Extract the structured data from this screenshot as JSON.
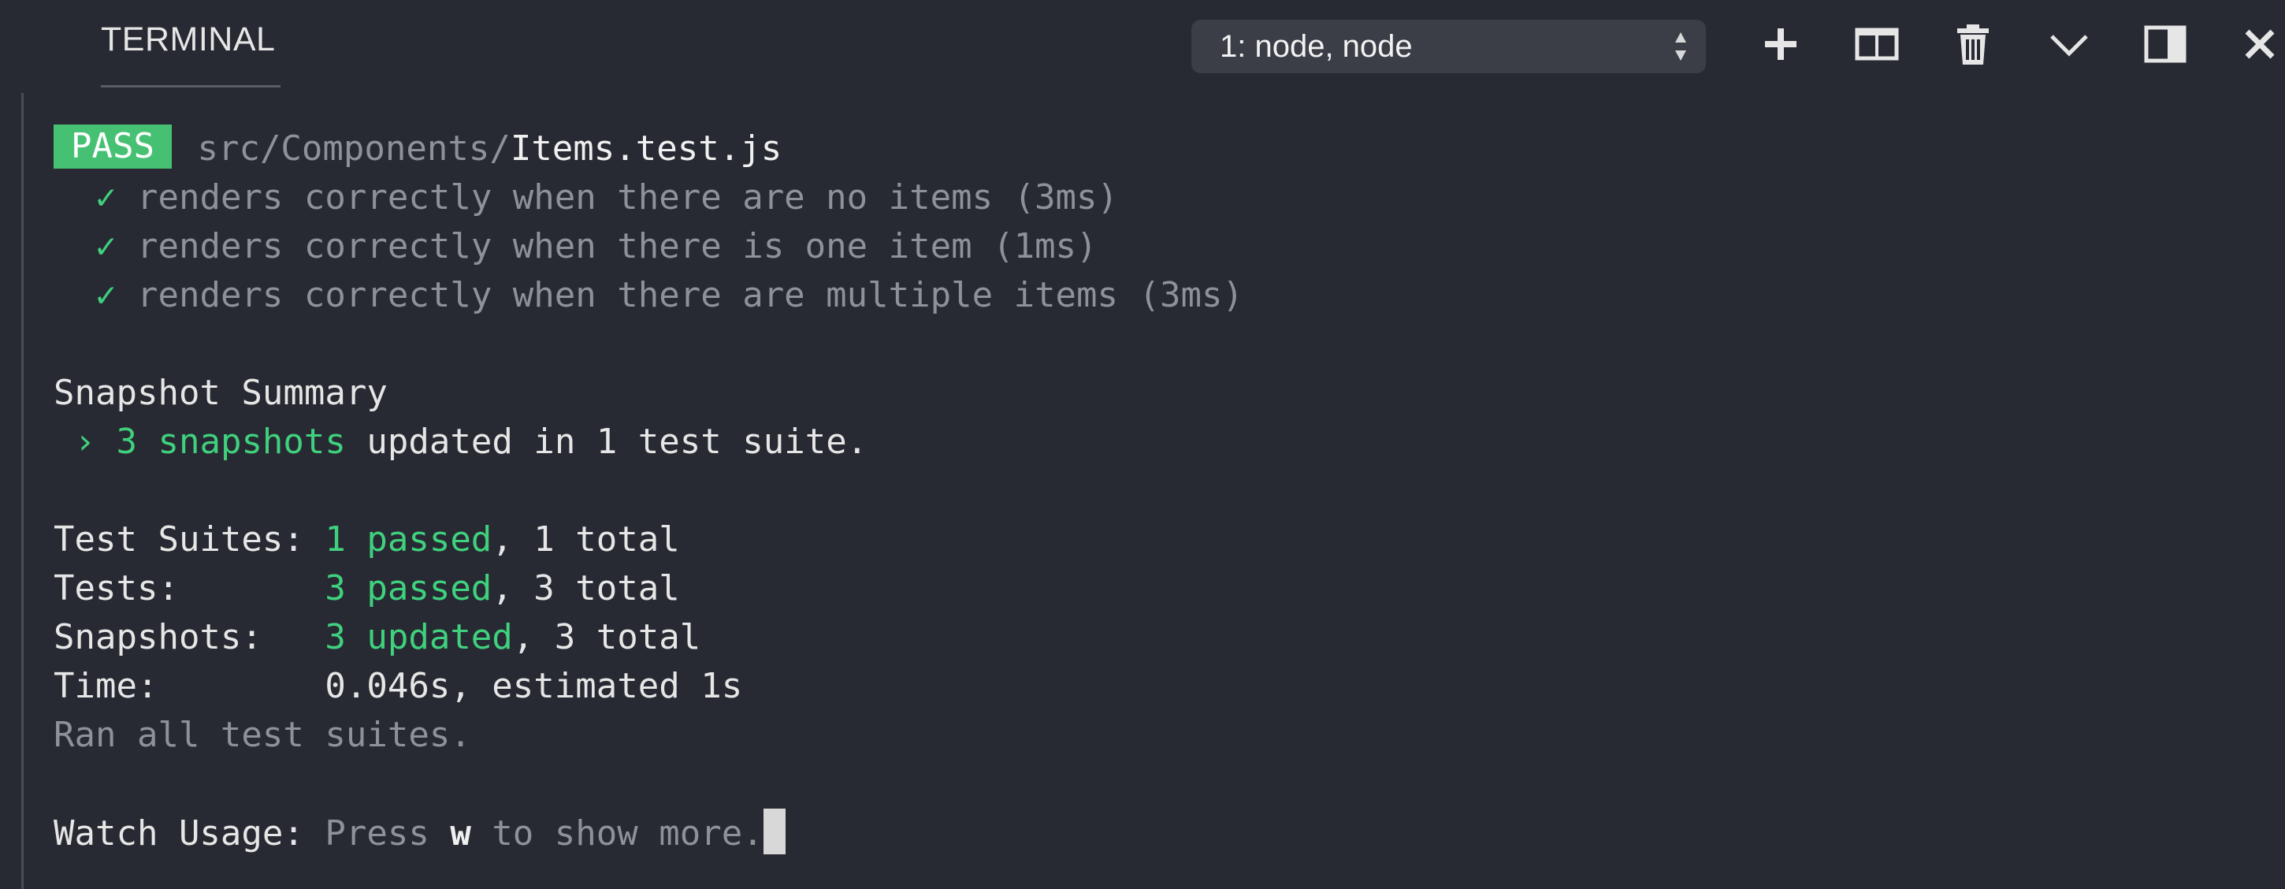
{
  "header": {
    "tab_title": "TERMINAL",
    "terminal_select": "1: node, node",
    "icons": [
      "plus-icon",
      "split-icon",
      "trash-icon",
      "chevron-down-icon",
      "panel-icon",
      "close-icon"
    ]
  },
  "terminal": {
    "pass_badge": "PASS",
    "file_path_dir": "src/Components/",
    "file_name": "Items.test.js",
    "check_mark": "✓",
    "tests": [
      "renders correctly when there are no items (3ms)",
      "renders correctly when there is one item (1ms)",
      "renders correctly when there are multiple items (3ms)"
    ],
    "snapshot_summary_title": "Snapshot Summary",
    "snapshot_arrow": "›",
    "snapshot_count": "3 snapshots",
    "snapshot_rest": "updated in 1 test suite.",
    "suites_label": "Test Suites: ",
    "suites_passed": "1 passed",
    "suites_total": ", 1 total",
    "tests_label": "Tests:       ",
    "tests_passed": "3 passed",
    "tests_total": ", 3 total",
    "snapshots_label": "Snapshots:   ",
    "snapshots_updated": "3 updated",
    "snapshots_total": ", 3 total",
    "time_label": "Time:        ",
    "time_value": "0.046s, estimated 1s",
    "ran_all": "Ran all test suites.",
    "watch_label": "Watch Usage: ",
    "watch_press": "Press ",
    "watch_key": "w",
    "watch_rest": " to show more."
  }
}
